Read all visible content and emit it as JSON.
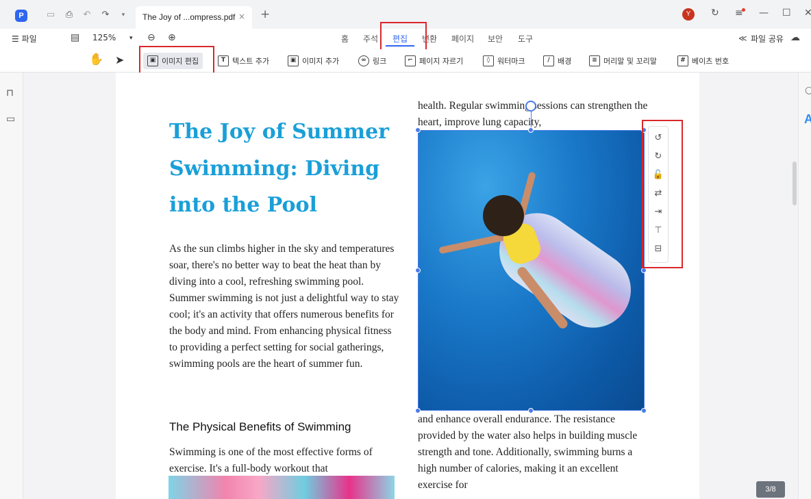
{
  "titlebar": {
    "tab_title": "The Joy of ...ompress.pdf",
    "tab_close": "×",
    "new_tab": "+",
    "avatar_initial": "Y"
  },
  "menubar": {
    "file_label": "☰ 파일",
    "zoom": "125%",
    "tabs": [
      "홈",
      "주석",
      "편집",
      "변환",
      "페이지",
      "보안",
      "도구"
    ],
    "active_tab": "편집",
    "share_label": "파일 공유"
  },
  "toolbar": {
    "items": [
      {
        "label": "이미지 편집",
        "icon": "image-edit-icon",
        "glyph": "▣"
      },
      {
        "label": "텍스트 추가",
        "icon": "text-add-icon",
        "glyph": "T"
      },
      {
        "label": "이미지 추가",
        "icon": "image-add-icon",
        "glyph": "▣"
      },
      {
        "label": "링크",
        "icon": "link-icon",
        "glyph": "∞"
      },
      {
        "label": "페이지 자르기",
        "icon": "crop-icon",
        "glyph": "⌐"
      },
      {
        "label": "워터마크",
        "icon": "watermark-icon",
        "glyph": "◊"
      },
      {
        "label": "배경",
        "icon": "background-icon",
        "glyph": "/"
      },
      {
        "label": "머리말 및 꼬리말",
        "icon": "header-footer-icon",
        "glyph": "≡"
      },
      {
        "label": "베이츠 번호",
        "icon": "bates-number-icon",
        "glyph": "#"
      }
    ]
  },
  "document": {
    "title": "The Joy of Summer Swimming: Diving into the Pool",
    "intro_paragraph": "As the sun climbs higher in the sky and temperatures soar, there's no better way to beat the heat than by diving into a cool, refreshing swimming pool. Summer swimming is not just a delightful way to stay cool; it's an activity that offers numerous benefits for the body and mind. From enhancing physical fitness to providing a perfect setting for social gatherings, swimming pools are the heart of summer fun.",
    "subheading": "The Physical Benefits of Swimming",
    "left_para2": "Swimming is one of the most effective forms of exercise. It's a full-body workout that",
    "right_top": "health. Regular swimming sessions can strengthen the heart, improve lung capacity,",
    "right_bottom": "and enhance overall endurance. The resistance provided by the water also helps in building muscle strength and tone. Additionally, swimming burns a high number of calories, making it an excellent exercise for"
  },
  "image_toolbar": [
    {
      "icon": "rotate-left-icon",
      "glyph": "↺"
    },
    {
      "icon": "rotate-right-icon",
      "glyph": "↻"
    },
    {
      "icon": "unlock-icon",
      "glyph": "🔓"
    },
    {
      "icon": "replace-image-icon",
      "glyph": "⇄"
    },
    {
      "icon": "extract-image-icon",
      "glyph": "⇥"
    },
    {
      "icon": "align-top-icon",
      "glyph": "⊤"
    },
    {
      "icon": "align-middle-icon",
      "glyph": "⊟"
    }
  ],
  "page_indicator": "3/8",
  "colors": {
    "accent": "#2f66f0",
    "title_blue": "#1a9fd8",
    "highlight_red": "#d9262a"
  }
}
